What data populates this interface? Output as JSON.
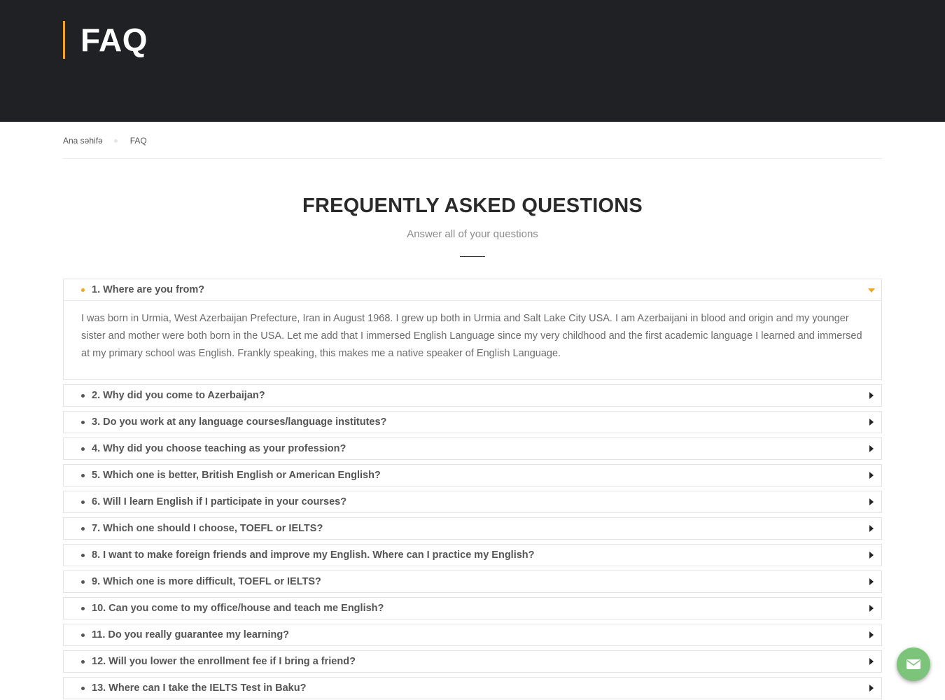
{
  "hero": {
    "title": "FAQ"
  },
  "breadcrumb": {
    "home": "Ana səhifə",
    "current": "FAQ"
  },
  "section": {
    "title": "FREQUENTLY ASKED QUESTIONS",
    "subtitle": "Answer all of your questions"
  },
  "faq": {
    "items": [
      {
        "question": "1. Where are you from?",
        "expanded": true,
        "answer": "I was born in Urmia, West Azerbaijan Prefecture, Iran in August 1968. I grew up both in Urmia and Salt Lake City USA. I am Azerbaijani in blood and origin and my younger sister and mother were both born in the USA. Let me add that I immersed English Language since my very childhood and the first academic language I learned and immersed at my primary school was English. Frankly speaking, this makes me a native speaker of English Language."
      },
      {
        "question": "2. Why did you come to Azerbaijan?",
        "expanded": false
      },
      {
        "question": "3. Do you work at any language courses/language institutes?",
        "expanded": false
      },
      {
        "question": "4. Why did you choose teaching as your profession?",
        "expanded": false
      },
      {
        "question": "5. Which one is better, British English or American English?",
        "expanded": false
      },
      {
        "question": "6. Will I learn English if I participate in your courses?",
        "expanded": false
      },
      {
        "question": "7. Which one should I choose, TOEFL or IELTS?",
        "expanded": false
      },
      {
        "question": "8. I want to make foreign friends and improve my English. Where can I practice my English?",
        "expanded": false
      },
      {
        "question": "9. Which one is more difficult, TOEFL or IELTS?",
        "expanded": false
      },
      {
        "question": "10. Can you come to my office/house and teach me English?",
        "expanded": false
      },
      {
        "question": "11. Do you really guarantee my learning?",
        "expanded": false
      },
      {
        "question": "12. Will you lower the enrollment fee if I bring a friend?",
        "expanded": false
      },
      {
        "question": "13. Where can I take the IELTS Test in Baku?",
        "expanded": false
      }
    ]
  },
  "colors": {
    "hero_bg": "#1f2125",
    "accent": "#f2a51a",
    "chat_button": "#7cc47a"
  },
  "icons": {
    "chat": "envelope-icon",
    "expanded": "caret-down-icon",
    "collapsed": "caret-right-icon"
  }
}
